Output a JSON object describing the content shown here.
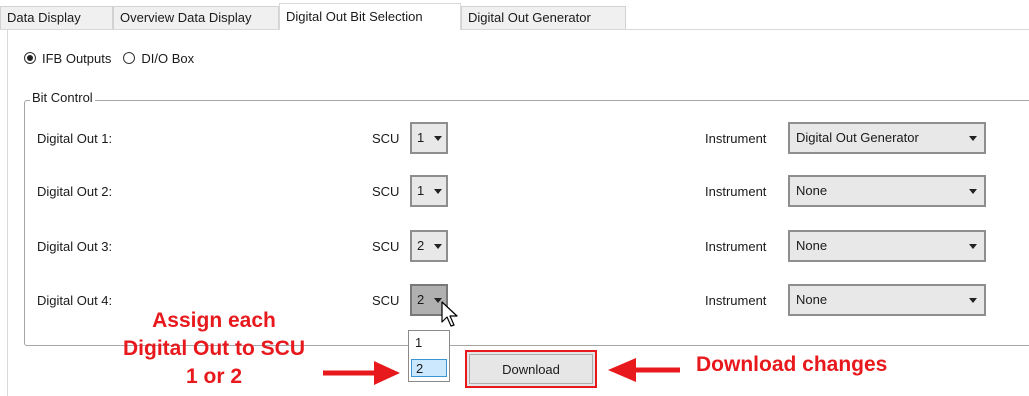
{
  "tabs": [
    {
      "label": "Data Display",
      "active": false
    },
    {
      "label": "Overview Data Display",
      "active": false
    },
    {
      "label": "Digital Out Bit Selection",
      "active": true
    },
    {
      "label": "Digital Out Generator",
      "active": false
    }
  ],
  "output_type": {
    "options": [
      {
        "label": "IFB Outputs",
        "checked": true
      },
      {
        "label": "DI/O Box",
        "checked": false
      }
    ]
  },
  "bit_control": {
    "title": "Bit Control",
    "scu_label": "SCU",
    "instrument_label": "Instrument",
    "rows": [
      {
        "label": "Digital Out 1:",
        "scu": "1",
        "instrument": "Digital Out Generator"
      },
      {
        "label": "Digital Out 2:",
        "scu": "1",
        "instrument": "None"
      },
      {
        "label": "Digital Out 3:",
        "scu": "2",
        "instrument": "None"
      },
      {
        "label": "Digital Out 4:",
        "scu": "2",
        "instrument": "None"
      }
    ]
  },
  "scu_dropdown": {
    "options": [
      "1",
      "2"
    ],
    "selected": "2"
  },
  "download_button": {
    "label": "Download"
  },
  "annotations": {
    "assign_lines": [
      "Assign each",
      "Digital Out to SCU",
      "1 or 2"
    ],
    "download_changes": "Download changes",
    "color": "#e8191d"
  },
  "icons": {
    "dropdown_arrow": "chevron-down-icon",
    "cursor": "mouse-pointer-icon"
  }
}
